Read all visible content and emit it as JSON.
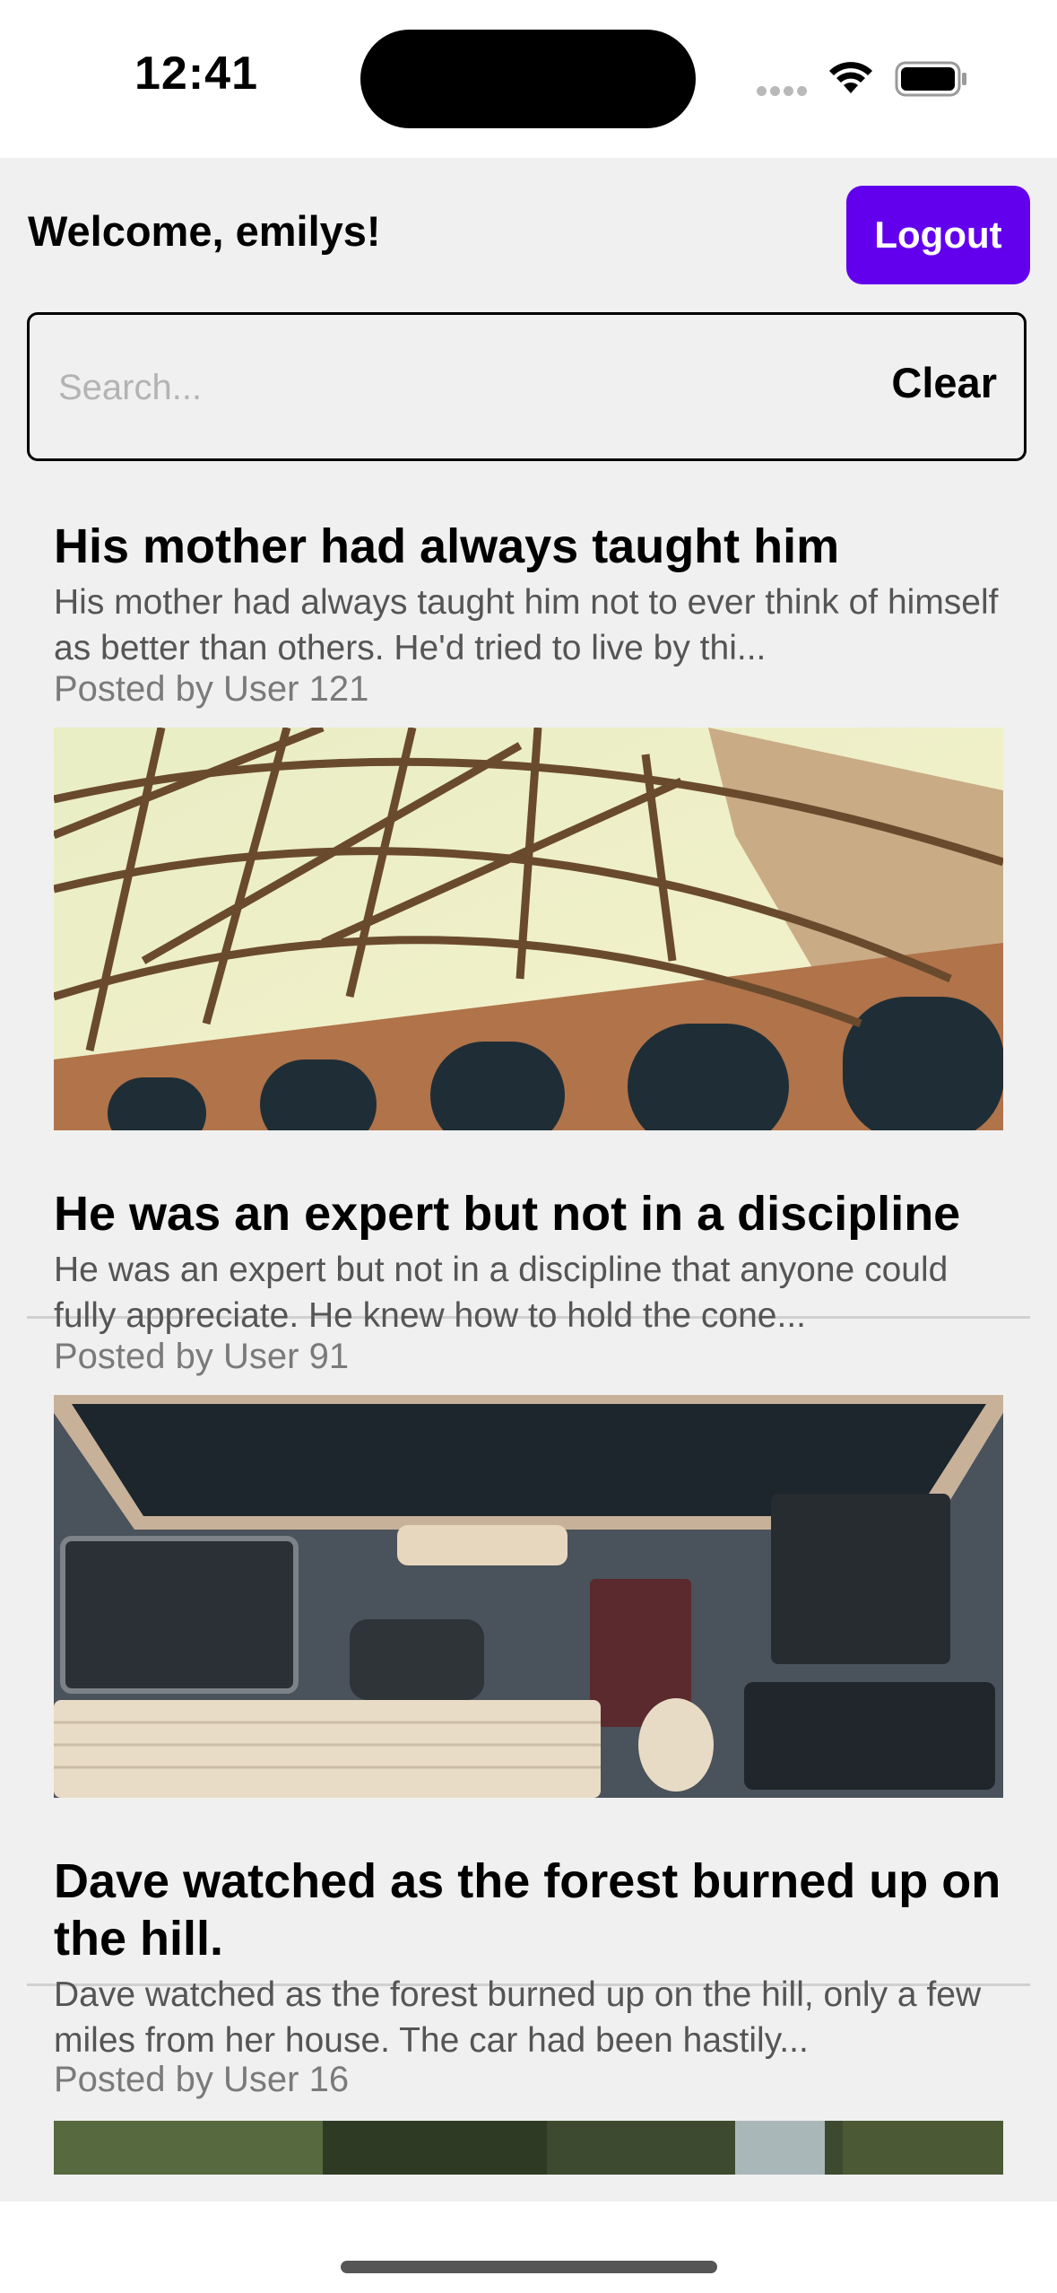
{
  "status_bar": {
    "time": "12:41",
    "icons": [
      "signal-dots-icon",
      "wifi-icon",
      "battery-icon"
    ]
  },
  "header": {
    "welcome_text": "Welcome, emilys!",
    "logout_label": "Logout",
    "accent_color": "#6200ee"
  },
  "search": {
    "placeholder": "Search...",
    "value": "",
    "clear_label": "Clear"
  },
  "posts": [
    {
      "title": "His mother had always taught him",
      "body": "His mother had always taught him not to ever think of himself as better than others. He'd tried to live by thi...",
      "author": "Posted by User 121",
      "image": "bridge-photo"
    },
    {
      "title": "He was an expert but not in a discipline",
      "body": "He was an expert but not in a discipline that anyone could fully appreciate. He knew how to hold the cone...",
      "author": "Posted by User 91",
      "image": "desk-setup-photo"
    },
    {
      "title": "Dave watched as the forest burned up on the hill.",
      "body": "Dave watched as the forest burned up on the hill, only a few miles from her house. The car had been hastily...",
      "author": "Posted by User 16",
      "image": "forest-photo"
    }
  ]
}
